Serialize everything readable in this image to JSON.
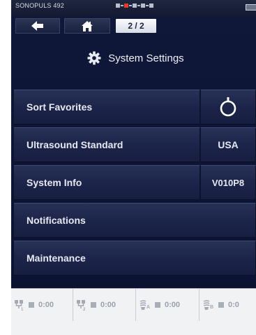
{
  "status_bar": {
    "brand": "SONOPULS 492"
  },
  "nav": {
    "back_icon": "arrow-left-icon",
    "home_icon": "home-icon",
    "page": "2 / 2"
  },
  "title": {
    "icon": "gear-icon",
    "text": "System Settings"
  },
  "menu": {
    "sort_favorites": {
      "label": "Sort Favorites",
      "value_icon": "clock-icon"
    },
    "ultrasound_standard": {
      "label": "Ultrasound Standard",
      "value": "USA"
    },
    "system_info": {
      "label": "System Info",
      "value": "V010P8"
    },
    "notifications": {
      "label": "Notifications"
    },
    "maintenance": {
      "label": "Maintenance"
    }
  },
  "channels": [
    {
      "icon": "electrode-1-icon",
      "time": "0:00"
    },
    {
      "icon": "electrode-2-icon",
      "time": "0:00"
    },
    {
      "icon": "ultrasound-a-icon",
      "time": "0:00"
    },
    {
      "icon": "ultrasound-b-icon",
      "time": "0:0"
    }
  ],
  "colors": {
    "background": "#0a1130",
    "panel": "#1c244a",
    "text": "#e6e9f2",
    "status_red": "#e33a2a",
    "bottom_bar": "#f1f2f4"
  }
}
